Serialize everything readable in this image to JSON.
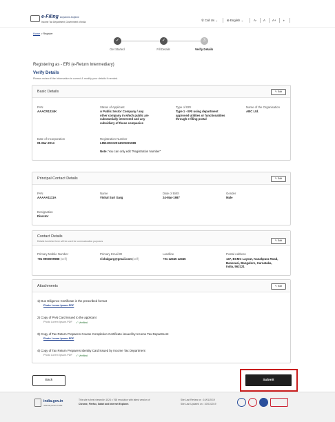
{
  "header": {
    "logo_title": "e-Filing",
    "logo_suffix": "Anywhere Anytime",
    "logo_sub": "Income Tax Department, Government of India",
    "call_us": "Call Us",
    "language": "English",
    "a_minus": "A-",
    "a_normal": "A",
    "a_plus": "A+",
    "contrast": "◑"
  },
  "breadcrumb": {
    "home": "Home",
    "sep": ">",
    "current": "Register"
  },
  "stepper": {
    "steps": [
      {
        "label": "Get Started",
        "mark": "✓"
      },
      {
        "label": "Fill Details",
        "mark": "✓"
      },
      {
        "label": "Verify Details",
        "mark": "3"
      }
    ]
  },
  "page": {
    "registering_prefix": "Registering as - ",
    "registering_value": "ERI (e-Return Intermediary)",
    "title": "Verify Details",
    "subtitle": "Please review if the information is correct & modify your details if needed."
  },
  "edit_label": "Edit",
  "basic": {
    "title": "Basic Details",
    "pan_label": "PAN",
    "pan": "AAACR1234K",
    "status_label": "Status of Applicant",
    "status_lines": [
      "A Public Sector Company / any",
      "other company in which public are",
      "substantially interested and any",
      "subsidiary of those companies"
    ],
    "type_label": "Type of ERI",
    "type_lines": [
      "Type 1 - ERI using department",
      "approved utilities or functionalities",
      "through e-filing portal"
    ],
    "org_label": "Name of the Organisation",
    "org": "ABC Ltd.",
    "doi_label": "Date of Incorporation",
    "doi": "01-Mar-2014",
    "reg_label": "Registration Number",
    "reg": "L85110KA2014GOI221989",
    "note_bold": "Note:",
    "note_text": "You can only edit \"Registration Number\""
  },
  "principal": {
    "title": "Principal Contact Details",
    "pan_label": "PAN",
    "pan": "AAAAA1111A",
    "name_label": "Name",
    "name": "Vishal Suri Garg",
    "dob_label": "Date of Birth",
    "dob": "24-Mar-1987",
    "gender_label": "Gender",
    "gender": "Male",
    "desig_label": "Designation",
    "desig": "Director"
  },
  "contact": {
    "title": "Contact Details",
    "desc": "Details furnished here will be used for communication purposes",
    "mobile_label": "Primary Mobile Number",
    "mobile": "+91 9900009988",
    "mobile_tag": "(self)",
    "email_label": "Primary Email ID",
    "email": "vishalgarg@gmail.com",
    "email_tag": "(self)",
    "landline_label": "Landline",
    "landline": "+91 12345 12345",
    "address_label": "Postal Address",
    "address_lines": [
      "137, BCMC Layout, Kanakpura Road,",
      "Banavasi, Bangalore, Karnataka,",
      "India, 562121"
    ]
  },
  "attachments": {
    "title": "Attachments",
    "items": [
      {
        "text": "1)  Due Diligence Certificate in the prescribed format",
        "file": "Photo Lorem Ipsum.PDF",
        "verified": ""
      },
      {
        "text": "2)  Copy of PAN Card issued to the applicant",
        "file": "Photo Lorem Ipsum.PDF",
        "verified": "✓ Verified"
      },
      {
        "text": "3)  Copy of Tax Return Preparers Course Completion Certificate issued by Income Tax Department",
        "file": "Photo Lorem Ipsum.PDF",
        "verified": ""
      },
      {
        "text": "4)  Copy of Tax Return Preparers Identity Card issued by Income Tax Department",
        "file": "Photo Lorem Ipsum.PDF",
        "verified": "✓ Verified"
      }
    ]
  },
  "buttons": {
    "back": "Back",
    "submit": "Submit"
  },
  "footer": {
    "site": "india.gov.in",
    "site_sub": "national portal of india",
    "browser_line1": "This site is best viewed in 1024 x 768 resolution with latest version of",
    "browser_line2": "Chrome, Firefox, Safari and Internet Explorer.",
    "reviewed": "Site Last Review on : 10/01/2019",
    "updated": "Site Last Updated on : 10/01/2019"
  },
  "colors": {
    "brand": "#1d3f7a",
    "submit_highlight": "#c91c1c",
    "verified": "#1f6e2b"
  }
}
